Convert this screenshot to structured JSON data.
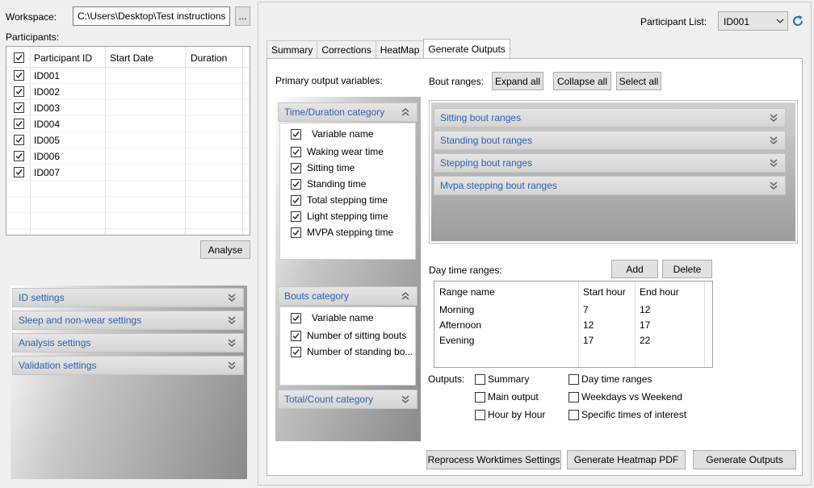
{
  "workspace": {
    "label": "Workspace:",
    "path": "C:\\Users\\Desktop\\Test instructions",
    "browse_label": "..."
  },
  "participants": {
    "label": "Participants:",
    "columns": [
      "Participant ID",
      "Start Date",
      "Duration"
    ],
    "rows": [
      {
        "id": "ID001",
        "start": "",
        "duration": "",
        "checked": true
      },
      {
        "id": "ID002",
        "start": "",
        "duration": "",
        "checked": true
      },
      {
        "id": "ID003",
        "start": "",
        "duration": "",
        "checked": true
      },
      {
        "id": "ID004",
        "start": "",
        "duration": "",
        "checked": true
      },
      {
        "id": "ID005",
        "start": "",
        "duration": "",
        "checked": true
      },
      {
        "id": "ID006",
        "start": "",
        "duration": "",
        "checked": true
      },
      {
        "id": "ID007",
        "start": "",
        "duration": "",
        "checked": true
      }
    ],
    "analyse_label": "Analyse"
  },
  "settings": {
    "items": [
      "ID settings",
      "Sleep and non-wear settings",
      "Analysis settings",
      "Validation settings"
    ]
  },
  "participant_list": {
    "label": "Participant List:",
    "selected": "ID001"
  },
  "tabs": [
    {
      "label": "Summary",
      "active": false
    },
    {
      "label": "Corrections",
      "active": false
    },
    {
      "label": "HeatMap",
      "active": false
    },
    {
      "label": "Generate Outputs",
      "active": true
    }
  ],
  "primary": {
    "label": "Primary output variables:",
    "time_category": {
      "title": "Time/Duration category",
      "header": "Variable name",
      "items": [
        "Waking wear time",
        "Sitting time",
        "Standing time",
        "Total stepping time",
        "Light stepping time",
        "MVPA stepping time"
      ]
    },
    "bouts_category": {
      "title": "Bouts category",
      "header": "Variable name",
      "items": [
        "Number of sitting bouts",
        "Number of standing bo..."
      ]
    },
    "total_category": {
      "title": "Total/Count category"
    }
  },
  "bout_ranges": {
    "label": "Bout ranges:",
    "expand_label": "Expand all",
    "collapse_label": "Collapse all",
    "select_label": "Select all",
    "items": [
      "Sitting bout ranges",
      "Standing bout ranges",
      "Stepping bout ranges",
      "Mvpa stepping bout ranges"
    ]
  },
  "day_time": {
    "label": "Day time ranges:",
    "add_label": "Add",
    "delete_label": "Delete",
    "columns": [
      "Range name",
      "Start hour",
      "End hour"
    ],
    "rows": [
      {
        "name": "Morning",
        "start": "7",
        "end": "12"
      },
      {
        "name": "Afternoon",
        "start": "12",
        "end": "17"
      },
      {
        "name": "Evening",
        "start": "17",
        "end": "22"
      }
    ]
  },
  "outputs": {
    "label": "Outputs:",
    "col1": [
      "Summary",
      "Main output",
      "Hour by Hour"
    ],
    "col2": [
      "Day time ranges",
      "Weekdays vs Weekend",
      "Specific times of interest"
    ]
  },
  "actions": {
    "reprocess_label": "Reprocess Worktimes Settings",
    "heatmap_label": "Generate Heatmap PDF",
    "generate_label": "Generate Outputs"
  },
  "colors": {
    "accent_text": "#2a62b3",
    "refresh": "#1e6fc5"
  }
}
